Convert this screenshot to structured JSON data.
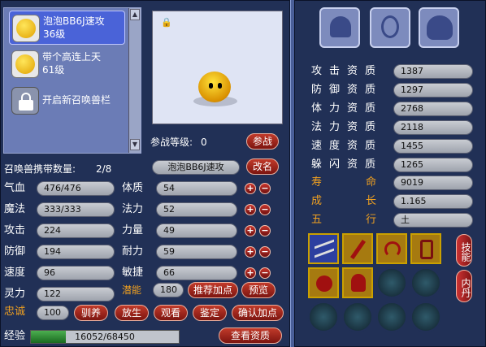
{
  "pets": [
    {
      "name": "泡泡BB6J速攻",
      "level": "36级",
      "selected": true
    },
    {
      "name": "带个高连上天",
      "level": "61级",
      "selected": false
    }
  ],
  "open_slot_label": "开启新召唤兽栏",
  "join_level_label": "参战等级:",
  "join_level_value": "0",
  "join_battle_button": "参战",
  "carry_label": "召唤兽携带数量:",
  "carry_value": "2/8",
  "current_name": "泡泡BB6J速攻",
  "rename_button": "改名",
  "stats_left": [
    {
      "label": "气血",
      "value": "476/476"
    },
    {
      "label": "魔法",
      "value": "333/333"
    },
    {
      "label": "攻击",
      "value": "224"
    },
    {
      "label": "防御",
      "value": "194"
    },
    {
      "label": "速度",
      "value": "96"
    },
    {
      "label": "灵力",
      "value": "122"
    }
  ],
  "stats_right": [
    {
      "label": "体质",
      "value": "54"
    },
    {
      "label": "法力",
      "value": "52"
    },
    {
      "label": "力量",
      "value": "49"
    },
    {
      "label": "耐力",
      "value": "59"
    },
    {
      "label": "敏捷",
      "value": "66"
    }
  ],
  "potential_label": "潜能",
  "potential_value": "180",
  "recommend_button": "推荐加点",
  "preview_button": "预览",
  "loyalty_label": "忠诚",
  "loyalty_value": "100",
  "bottom_buttons": [
    "驯养",
    "放生",
    "观看",
    "鉴定",
    "确认加点"
  ],
  "exp_label": "经验",
  "exp_value": "16052/68450",
  "exp_fraction": 0.2345,
  "view_aptitude_button": "查看资质",
  "aptitudes": [
    {
      "label": "攻击资质",
      "value": "1387"
    },
    {
      "label": "防御资质",
      "value": "1297"
    },
    {
      "label": "体力资质",
      "value": "2768"
    },
    {
      "label": "法力资质",
      "value": "2118"
    },
    {
      "label": "速度资质",
      "value": "1455"
    },
    {
      "label": "躲闪资质",
      "value": "1265"
    }
  ],
  "lifespan_label": "寿命",
  "lifespan_value": "9019",
  "growth_label": "成长",
  "growth_value": "1.165",
  "element_label": "五行",
  "element_value": "土",
  "skills_tab": "技能",
  "neidan_tab": "内丹",
  "colors": {
    "panel": "#213056",
    "pill": "#b8bcc4",
    "button": "#a82a1e",
    "orange": "#f0a020"
  }
}
